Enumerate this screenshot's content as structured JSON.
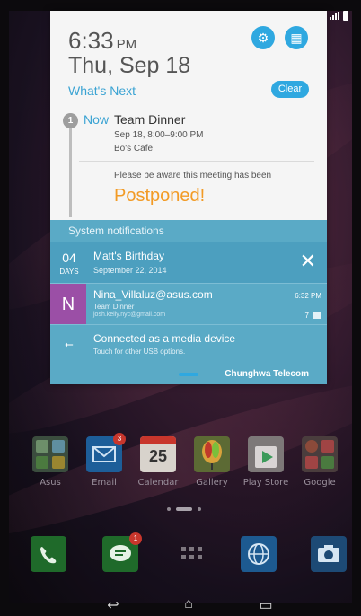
{
  "notification_panel": {
    "time": "6:33",
    "ampm": "PM",
    "date": "Thu, Sep 18",
    "whats_next_label": "What's Next",
    "clear_label": "Clear",
    "timeline": {
      "index": "1",
      "now_label": "Now",
      "event_title": "Team Dinner",
      "event_time": "Sep 18, 8:00–9:00 PM",
      "event_place": "Bo's Cafe",
      "notice": "Please be aware this meeting has been",
      "status": "Postponed!"
    },
    "system_header": "System notifications",
    "notifications": [
      {
        "days_num": "04",
        "days_label": "DAYS",
        "title": "Matt's Birthday",
        "subtitle": "September 22, 2014",
        "action": "✕"
      },
      {
        "avatar_letter": "N",
        "title": "Nina_Villaluz@asus.com",
        "subtitle": "Team Dinner",
        "subtitle2": "josh.kelly.nyc@gmail.com",
        "time": "6:32 PM",
        "count": "7"
      },
      {
        "title": "Connected as a media device",
        "subtitle": "Touch for other USB options."
      }
    ],
    "carrier": "Chunghwa Telecom"
  },
  "home": {
    "apps": [
      {
        "label": "Asus",
        "color": "#3b6b4a"
      },
      {
        "label": "Email",
        "color": "#1d5e99",
        "badge": "3"
      },
      {
        "label": "Calendar",
        "color": "#e8e4dd",
        "text": "25"
      },
      {
        "label": "Gallery",
        "color": "#7a8a3a"
      },
      {
        "label": "Play Store",
        "color": "#8d8a8a"
      },
      {
        "label": "Google",
        "color": "#7b4f4f"
      }
    ],
    "dock": [
      {
        "name": "phone",
        "color": "#1d6e2a"
      },
      {
        "name": "messages",
        "color": "#1f6e2a",
        "badge": "1"
      },
      {
        "name": "all-apps",
        "color": "transparent"
      },
      {
        "name": "browser",
        "color": "#1d5e99"
      },
      {
        "name": "camera",
        "color": "#1d5080"
      }
    ]
  },
  "navbar": {
    "back": "↩",
    "home": "⌂",
    "recents": "▭"
  }
}
